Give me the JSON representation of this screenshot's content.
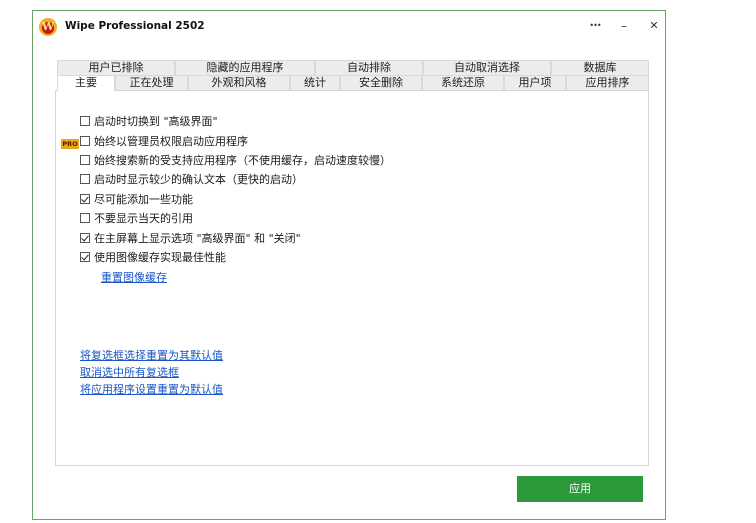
{
  "window": {
    "title": "Wipe Professional 2502",
    "logo_letter": "W",
    "more_glyph": "•••",
    "minimize_glyph": "–",
    "close_glyph": "✕"
  },
  "tabs_row1": [
    {
      "label": "用户已排除"
    },
    {
      "label": "隐藏的应用程序"
    },
    {
      "label": "自动排除"
    },
    {
      "label": "自动取消选择"
    },
    {
      "label": "数据库"
    }
  ],
  "tabs_row2": [
    {
      "label": "主要",
      "active": true
    },
    {
      "label": "正在处理"
    },
    {
      "label": "外观和风格"
    },
    {
      "label": "统计"
    },
    {
      "label": "安全删除"
    },
    {
      "label": "系统还原"
    },
    {
      "label": "用户项"
    },
    {
      "label": "应用排序"
    }
  ],
  "pro_badge": "PRO",
  "options": [
    {
      "label": "启动时切换到 \"高级界面\"",
      "checked": false
    },
    {
      "label": "始终以管理员权限启动应用程序",
      "checked": false,
      "pro": true
    },
    {
      "label": "始终搜索新的受支持应用程序（不使用缓存，启动速度较慢）",
      "checked": false
    },
    {
      "label": "启动时显示较少的确认文本（更快的启动）",
      "checked": false
    },
    {
      "label": "尽可能添加一些功能",
      "checked": true
    },
    {
      "label": "不要显示当天的引用",
      "checked": false
    },
    {
      "label": "在主屏幕上显示选项 \"高级界面\" 和 \"关闭\"",
      "checked": true
    },
    {
      "label": "使用图像缓存实现最佳性能",
      "checked": true
    }
  ],
  "links": {
    "reset_image_cache": "重置图像缓存",
    "reset_checkboxes": "将复选框选择重置为其默认值",
    "uncheck_all": "取消选中所有复选框",
    "reset_app_settings": "将应用程序设置重置为默认值"
  },
  "apply_label": "应用",
  "colors": {
    "accent_green": "#2c9a3a",
    "link_blue": "#1a56c7",
    "pro_badge": "#e7a91a"
  }
}
